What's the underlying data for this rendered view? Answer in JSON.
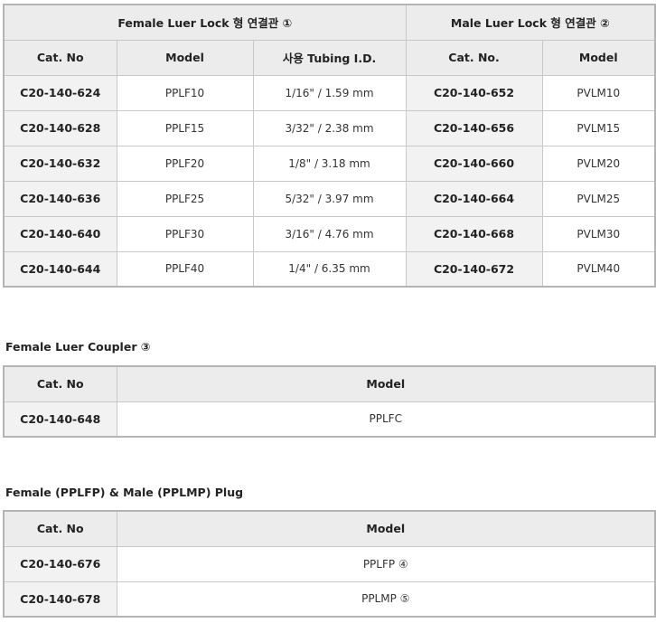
{
  "table1": {
    "group_female": "Female Luer Lock 형 연결관 ①",
    "group_male": "Male Luer Lock 형 연결관 ②",
    "headers": [
      "Cat. No",
      "Model",
      "사용 Tubing I.D.",
      "Cat. No.",
      "Model"
    ],
    "rows": [
      [
        "C20-140-624",
        "PPLF10",
        "1/16\" / 1.59 mm",
        "C20-140-652",
        "PVLM10"
      ],
      [
        "C20-140-628",
        "PPLF15",
        "3/32\" / 2.38 mm",
        "C20-140-656",
        "PVLM15"
      ],
      [
        "C20-140-632",
        "PPLF20",
        "1/8\" / 3.18 mm",
        "C20-140-660",
        "PVLM20"
      ],
      [
        "C20-140-636",
        "PPLF25",
        "5/32\" / 3.97 mm",
        "C20-140-664",
        "PVLM25"
      ],
      [
        "C20-140-640",
        "PPLF30",
        "3/16\" / 4.76 mm",
        "C20-140-668",
        "PVLM30"
      ],
      [
        "C20-140-644",
        "PPLF40",
        "1/4\" / 6.35 mm",
        "C20-140-672",
        "PVLM40"
      ]
    ]
  },
  "section2": {
    "title": "Female Luer Coupler ③",
    "headers": [
      "Cat. No",
      "Model"
    ],
    "rows": [
      [
        "C20-140-648",
        "PPLFC"
      ]
    ]
  },
  "section3": {
    "title": "Female (PPLFP) & Male (PPLMP) Plug",
    "headers": [
      "Cat. No",
      "Model"
    ],
    "rows": [
      [
        "C20-140-676",
        "PPLFP ④"
      ],
      [
        "C20-140-678",
        "PPLMP ⑤"
      ]
    ]
  }
}
